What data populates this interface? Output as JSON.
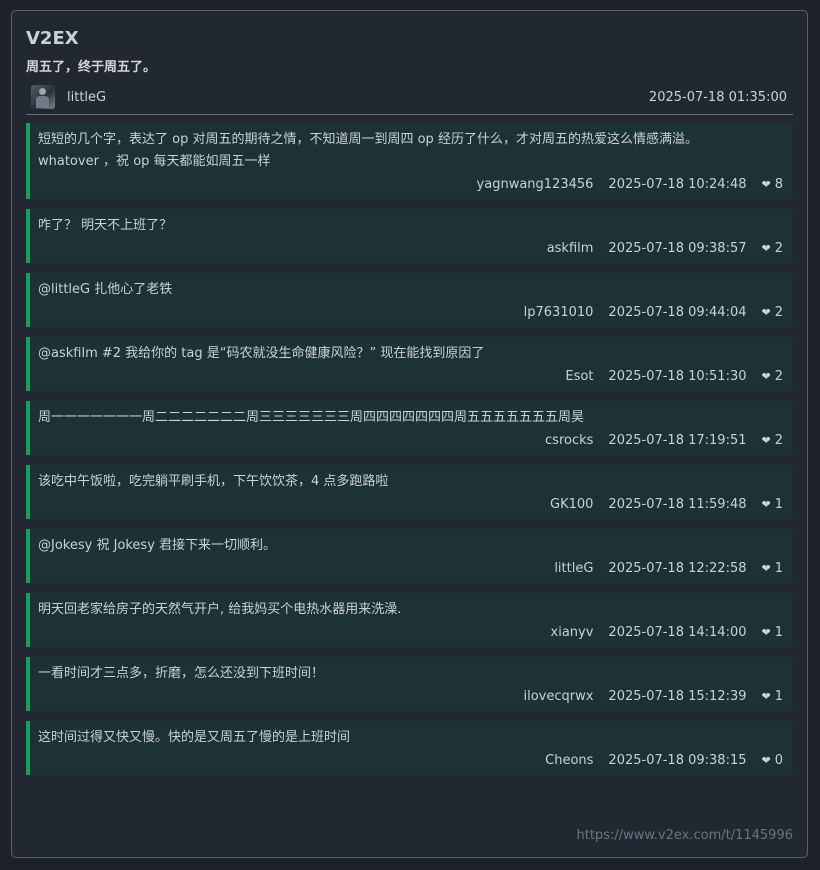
{
  "site": {
    "title": "V2EX"
  },
  "topic": {
    "title": "周五了，终于周五了。",
    "author": "littleG",
    "time": "2025-07-18 01:35:00"
  },
  "replies": [
    {
      "content": "短短的几个字，表达了 op 对周五的期待之情，不知道周一到周四 op 经历了什么，才对周五的热爱这么情感满溢。\nwhatover ，祝 op 每天都能如周五一样",
      "user": "yagnwang123456",
      "time": "2025-07-18 10:24:48",
      "likes": "8"
    },
    {
      "content": "咋了？ 明天不上班了？",
      "user": "askfilm",
      "time": "2025-07-18 09:38:57",
      "likes": "2"
    },
    {
      "content": "@littleG 扎他心了老铁",
      "user": "lp7631010",
      "time": "2025-07-18 09:44:04",
      "likes": "2"
    },
    {
      "content": "@askfilm #2 我给你的 tag 是“码农就没生命健康风险？” 现在能找到原因了",
      "user": "Esot",
      "time": "2025-07-18 10:51:30",
      "likes": "2"
    },
    {
      "content": "周一一一一一一一周二二二二二二二周三三三三三三三周四四四四四四四周五五五五五五五周昊",
      "user": "csrocks",
      "time": "2025-07-18 17:19:51",
      "likes": "2"
    },
    {
      "content": "该吃中午饭啦，吃完躺平刷手机，下午饮饮茶，4 点多跑路啦",
      "user": "GK100",
      "time": "2025-07-18 11:59:48",
      "likes": "1"
    },
    {
      "content": "@Jokesy 祝 Jokesy 君接下来一切顺利。",
      "user": "littleG",
      "time": "2025-07-18 12:22:58",
      "likes": "1"
    },
    {
      "content": "明天回老家给房子的天然气开户, 给我妈买个电热水器用来洗澡.",
      "user": "xianyv",
      "time": "2025-07-18 14:14:00",
      "likes": "1"
    },
    {
      "content": "一看时间才三点多，折磨，怎么还没到下班时间！",
      "user": "ilovecqrwx",
      "time": "2025-07-18 15:12:39",
      "likes": "1"
    },
    {
      "content": "这时间过得又快又慢。快的是又周五了慢的是上班时间",
      "user": "Cheons",
      "time": "2025-07-18 09:38:15",
      "likes": "0"
    }
  ],
  "footer": {
    "url": "https://www.v2ex.com/t/1145996"
  },
  "icons": {
    "like": "heart-icon",
    "avatar": "avatar-image"
  },
  "colors": {
    "accent": "#17a05f",
    "reply_bg": "#1e3134",
    "card_bg": "#222831",
    "page_bg": "#1e2228"
  }
}
